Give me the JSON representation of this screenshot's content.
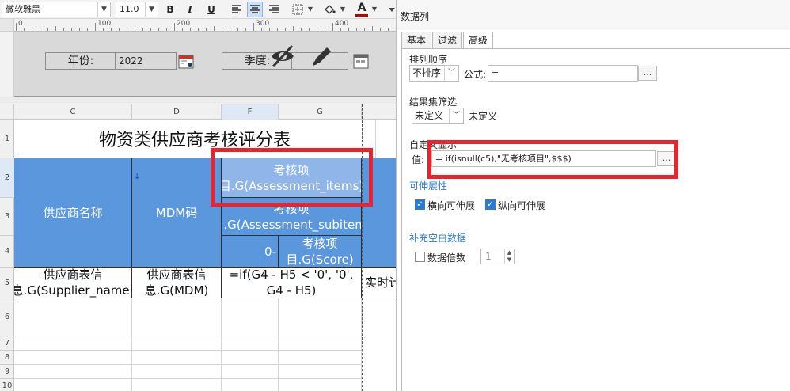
{
  "toolbar": {
    "font_name": "微软雅黑",
    "font_size": "11.0",
    "bold": "B",
    "italic": "I",
    "underline": "U",
    "text_color_letter": "A",
    "text_color": "#c00000"
  },
  "ruler": {
    "ticks": [
      "0",
      "100",
      "200",
      "300",
      "400"
    ]
  },
  "params": {
    "year_label": "年份:",
    "year_value": "2022",
    "quarter_label": "季度:"
  },
  "columns": [
    {
      "name": "C",
      "selected": false
    },
    {
      "name": "D",
      "selected": false
    },
    {
      "name": "F",
      "selected": true
    },
    {
      "name": "G",
      "selected": false
    }
  ],
  "rows": [
    "1",
    "2",
    "3",
    "4",
    "5",
    "6",
    "7",
    "8",
    "9",
    "10"
  ],
  "sheet": {
    "title": "物资类供应商考核评分表",
    "supplier_name_header": "供应商名称",
    "mdm_header": "MDM码",
    "assessment_items": "考核项目.G(Assessment_items)",
    "assessment_subitem": "考核项目.G(Assessment_subitem)",
    "score_prefix": "0-",
    "score": "考核项目.G(Score)",
    "supplier_name_cell": "供应商表信息.G(Supplier_name)",
    "mdm_cell": "供应商表信息.G(MDM)",
    "formula_cell": "=if(G4 - H5 < '0', '0', G4 - H5)",
    "realtime_cell": "实时计分"
  },
  "panel": {
    "title": "数据列",
    "tabs": [
      "基本",
      "过滤",
      "高级"
    ],
    "active_tab": "高级",
    "sort_section": "排列顺序",
    "sort_value": "不排序",
    "formula_label": "公式:",
    "formula_value": "=",
    "dots": "...",
    "filter_section": "结果集筛选",
    "filter_value": "未定义",
    "filter_desc": "未定义",
    "custom_display_section": "自定义显示",
    "value_label": "值:",
    "value_expr": "= if(isnull(c5),\"无考核项目\",$$$)",
    "extensible_section": "可伸展性",
    "horizontal_extend": "横向可伸展",
    "vertical_extend": "纵向可伸展",
    "fill_blank_section": "补充空白数据",
    "data_multiple": "数据倍数",
    "multiple_value": "1"
  }
}
